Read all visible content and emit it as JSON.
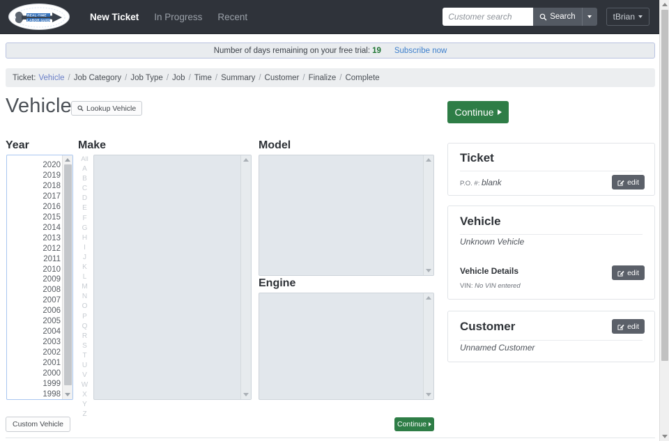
{
  "app": {
    "logo_text_line1": "REAL-TIME",
    "logo_text_line2": "LABOR GUIDE",
    "logo_icon": "wrench-arrow-logo"
  },
  "nav": {
    "links": [
      {
        "label": "New Ticket",
        "active": true
      },
      {
        "label": "In Progress",
        "active": false
      },
      {
        "label": "Recent",
        "active": false
      }
    ],
    "search": {
      "placeholder": "Customer search",
      "value": "",
      "button_label": "Search",
      "button_icon": "search-icon",
      "caret_icon": "caret-down-icon"
    },
    "user": {
      "label": "tBrian",
      "caret_icon": "caret-down-icon"
    }
  },
  "trial": {
    "message": "Number of days remaining on your free trial:",
    "days": "19",
    "subscribe_label": "Subscribe now"
  },
  "breadcrumb": {
    "label": "Ticket:",
    "items": [
      {
        "label": "Vehicle",
        "current": true
      },
      {
        "label": "Job Category",
        "current": false
      },
      {
        "label": "Job Type",
        "current": false
      },
      {
        "label": "Job",
        "current": false
      },
      {
        "label": "Time",
        "current": false
      },
      {
        "label": "Summary",
        "current": false
      },
      {
        "label": "Customer",
        "current": false
      },
      {
        "label": "Finalize",
        "current": false
      },
      {
        "label": "Complete",
        "current": false
      }
    ],
    "separator": "/"
  },
  "header": {
    "title": "Vehicle",
    "lookup_label": "Lookup Vehicle",
    "lookup_icon": "search-icon",
    "continue_label": "Continue",
    "continue_icon": "triangle-right-icon"
  },
  "columns": {
    "year": {
      "heading": "Year",
      "enabled": true,
      "options": [
        "2020",
        "2019",
        "2018",
        "2017",
        "2016",
        "2015",
        "2014",
        "2013",
        "2012",
        "2011",
        "2010",
        "2009",
        "2008",
        "2007",
        "2006",
        "2005",
        "2004",
        "2003",
        "2002",
        "2001",
        "2000",
        "1999",
        "1998"
      ],
      "selected": ""
    },
    "make": {
      "heading": "Make",
      "enabled": false,
      "options": [],
      "alpha_index": [
        "All",
        "A",
        "B",
        "C",
        "D",
        "E",
        "F",
        "G",
        "H",
        "I",
        "J",
        "K",
        "L",
        "M",
        "N",
        "O",
        "P",
        "Q",
        "R",
        "S",
        "T",
        "U",
        "V",
        "W",
        "X",
        "Y",
        "Z"
      ]
    },
    "model": {
      "heading": "Model",
      "enabled": false,
      "options": []
    },
    "engine": {
      "heading": "Engine",
      "enabled": false,
      "options": []
    }
  },
  "sidebar": {
    "ticket": {
      "title": "Ticket",
      "po_label": "P.O. #:",
      "po_value": "blank",
      "edit_label": "edit",
      "edit_icon": "pencil-square-icon"
    },
    "vehicle": {
      "title": "Vehicle",
      "summary": "Unknown Vehicle",
      "details_label": "Vehicle Details",
      "vin_label": "VIN:",
      "vin_value": "No VIN entered",
      "edit_label": "edit",
      "edit_icon": "pencil-square-icon"
    },
    "customer": {
      "title": "Customer",
      "summary": "Unnamed Customer",
      "edit_label": "edit",
      "edit_icon": "pencil-square-icon"
    }
  },
  "footer": {
    "custom_vehicle_label": "Custom Vehicle",
    "continue_label": "Continue",
    "continue_icon": "triangle-right-icon"
  },
  "colors": {
    "navbar": "#2f333a",
    "accent_green": "#2e7d46",
    "link_blue": "#3d7fcc",
    "current_crumb": "#6a7fc8",
    "trial_days_green": "#1c7430",
    "edit_btn_grey": "#5b6069",
    "disabled_list": "#e2e7ec"
  }
}
